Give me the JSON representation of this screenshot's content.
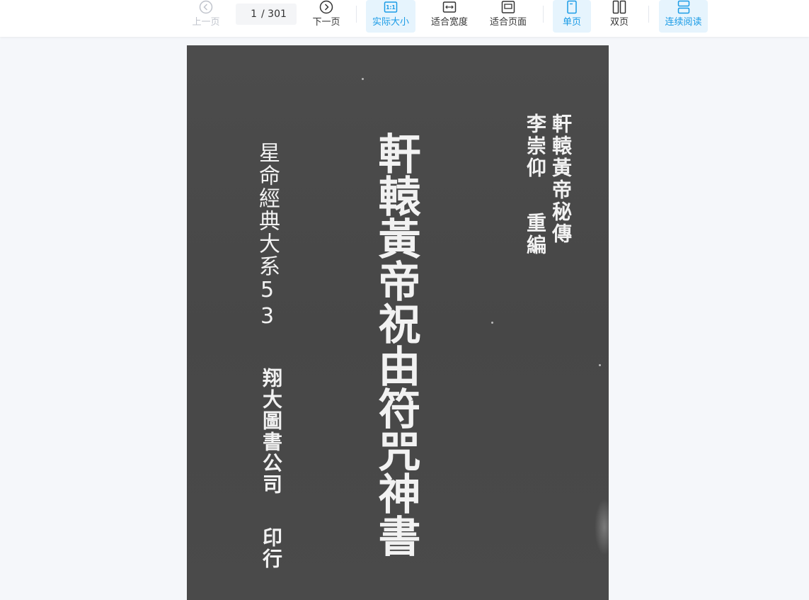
{
  "toolbar": {
    "prev_label": "上一页",
    "next_label": "下一页",
    "current_page": "1",
    "total_pages": "/ 301",
    "actual_size_label": "实际大小",
    "actual_size_icon_text": "1:1",
    "fit_width_label": "适合宽度",
    "fit_page_label": "适合页面",
    "single_page_label": "单页",
    "double_page_label": "双页",
    "continuous_label": "连续阅读"
  },
  "colors": {
    "accent": "#1a9be6",
    "active_bg": "#e6f4fd",
    "disabled": "#c0c4cc",
    "viewer_bg": "#f5f7fa",
    "cover_bg": "#4a4a4a",
    "cover_text": "#f2f2f2"
  },
  "cover": {
    "title": "軒轅黃帝祝由符咒神書",
    "series": "星命經典大系53",
    "publisher": "翔大圖書公司",
    "print_note": "印行",
    "subtitle": "軒轅黃帝秘傳",
    "author": "李崇仰",
    "author_role": "重編"
  }
}
